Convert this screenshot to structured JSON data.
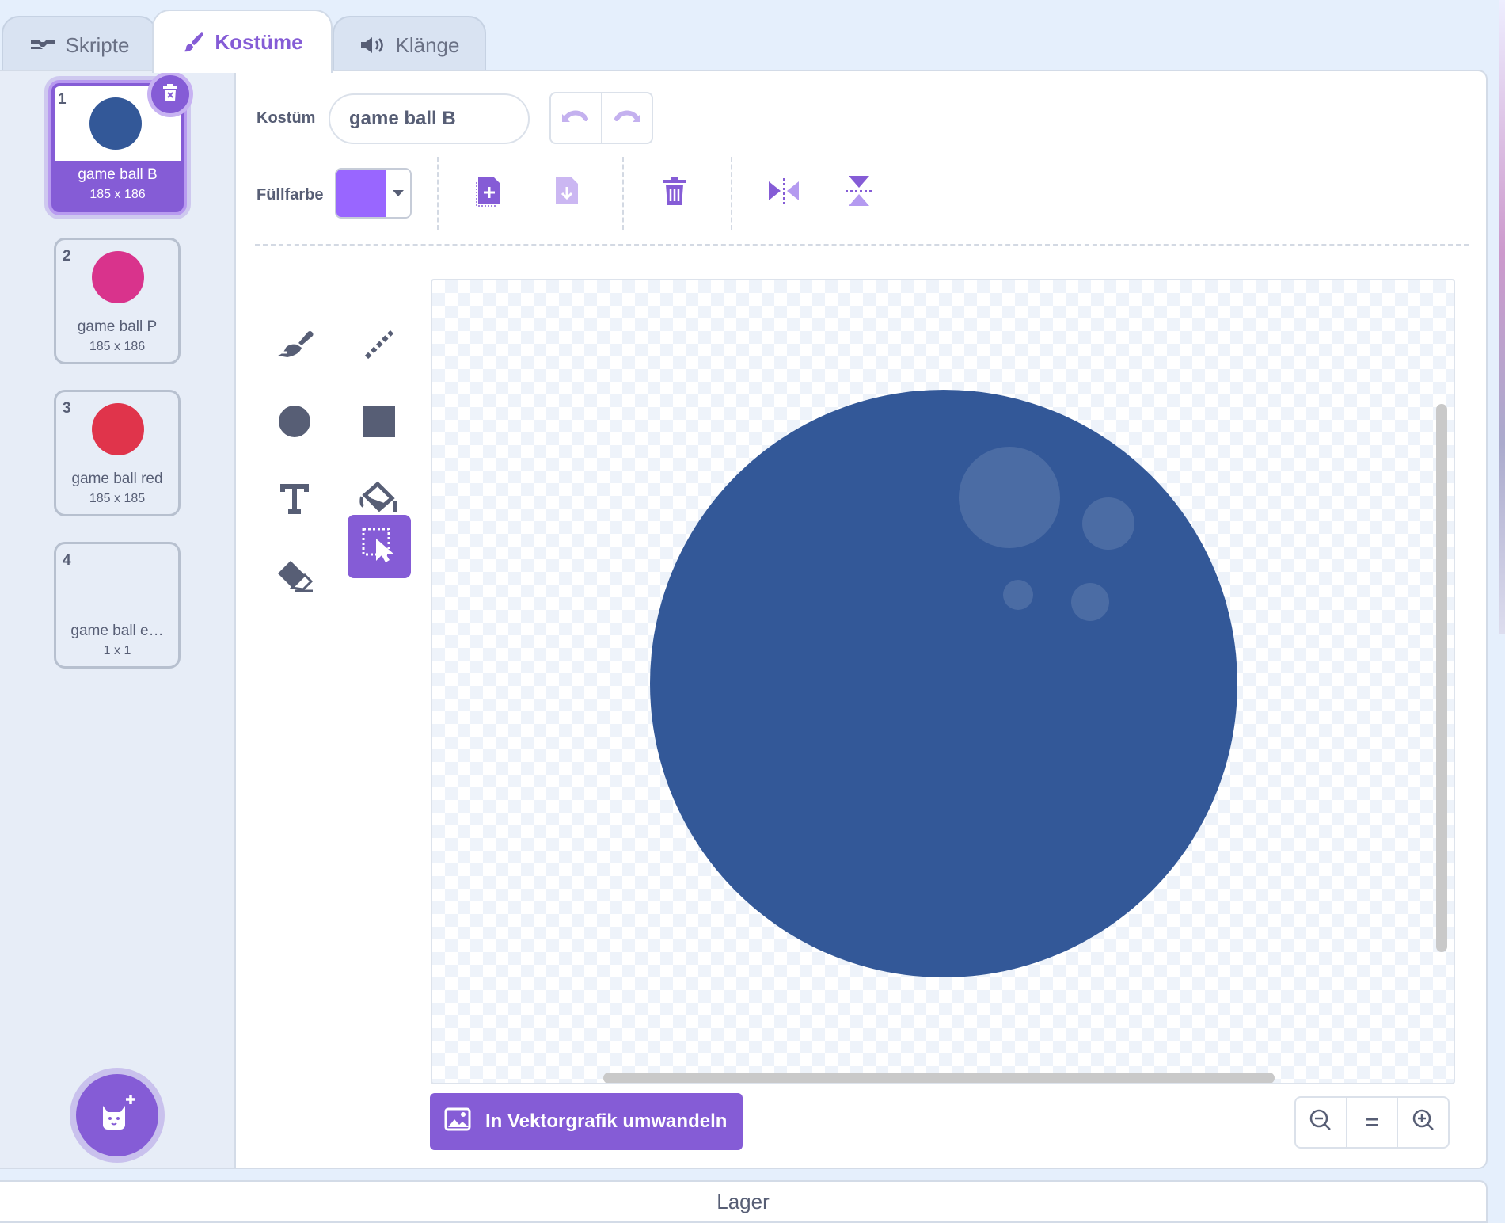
{
  "tabs": [
    {
      "label": "Skripte",
      "icon": "code-icon",
      "active": false
    },
    {
      "label": "Kostüme",
      "icon": "brush-icon",
      "active": true
    },
    {
      "label": "Klänge",
      "icon": "sound-icon",
      "active": false
    }
  ],
  "costumes": [
    {
      "number": "1",
      "name": "game ball B",
      "size": "185 x 186",
      "color": "#335898",
      "selected": true
    },
    {
      "number": "2",
      "name": "game ball P",
      "size": "185 x 186",
      "color": "#d9338c",
      "selected": false
    },
    {
      "number": "3",
      "name": "game ball red",
      "size": "185 x 185",
      "color": "#e0344b",
      "selected": false
    },
    {
      "number": "4",
      "name": "game ball e…",
      "size": "1 x 1",
      "color": "",
      "selected": false
    }
  ],
  "editor": {
    "costume_label": "Kostüm",
    "costume_name": "game ball B",
    "fill_label": "Füllfarbe",
    "fill_color": "#9966ff",
    "convert_label": "In Vektorgrafik umwandeln",
    "zoom_reset_label": "="
  },
  "tools": [
    "brush-icon",
    "line-icon",
    "circle-icon",
    "rectangle-icon",
    "text-icon",
    "fill-icon",
    "eraser-icon",
    "select-icon"
  ],
  "active_tool": "select-icon",
  "canvas": {
    "shape_color": "#335898"
  },
  "lager_label": "Lager",
  "colors": {
    "accent": "#855cd6",
    "tab_bg": "#d9e3f2",
    "background": "#e5effc"
  }
}
